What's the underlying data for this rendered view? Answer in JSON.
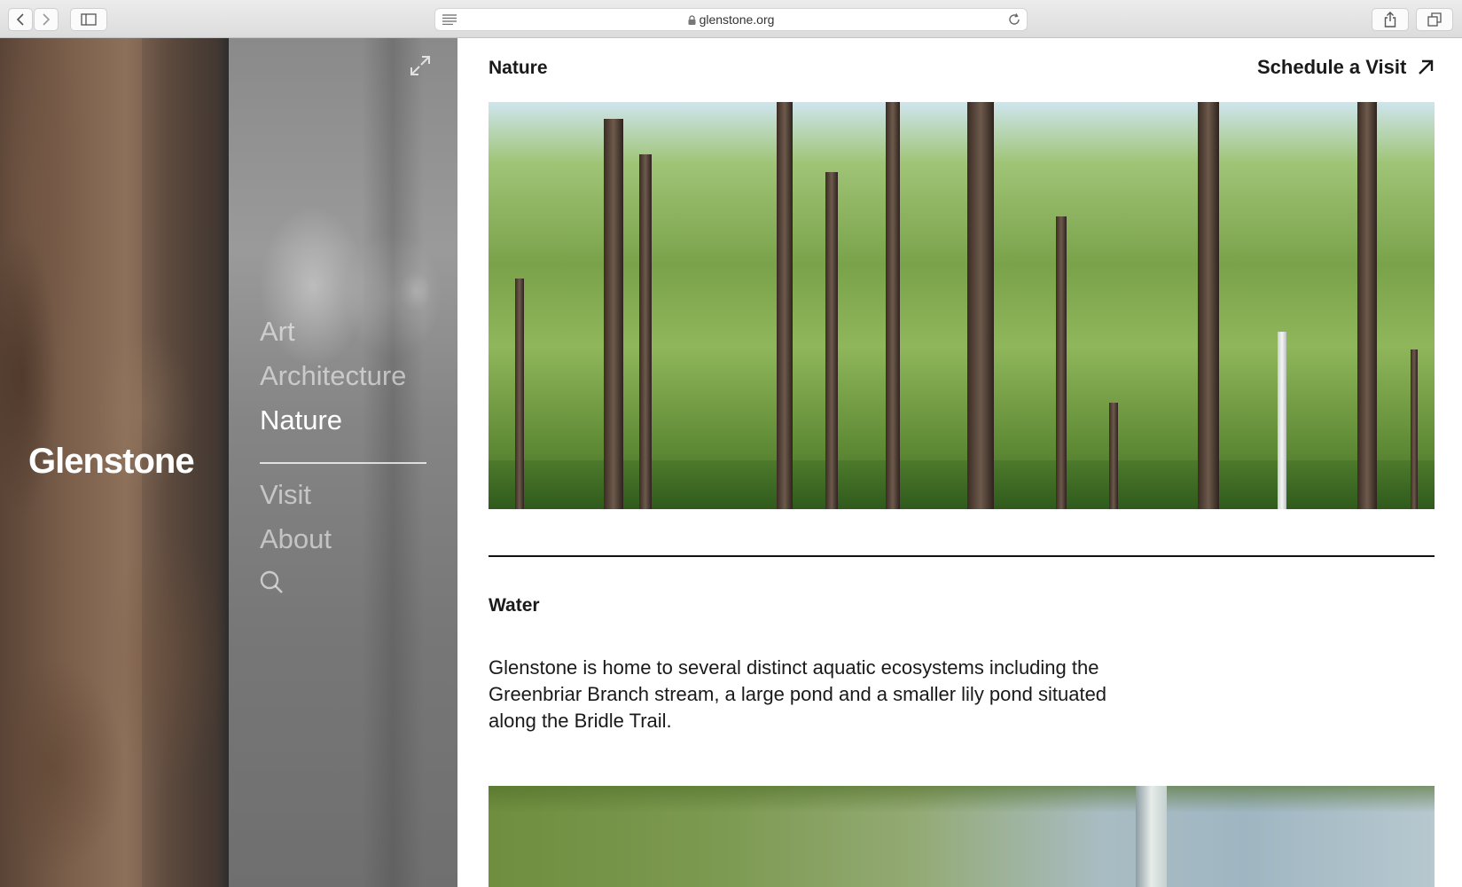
{
  "browser": {
    "url": "glenstone.org",
    "icons": [
      "back-icon",
      "forward-icon",
      "sidebar-icon",
      "reader-icon",
      "lock-icon",
      "reload-icon",
      "share-icon",
      "tabs-icon"
    ]
  },
  "hero": {
    "brand": "Glenstone"
  },
  "nav": {
    "items": [
      {
        "label": "Art",
        "active": false
      },
      {
        "label": "Architecture",
        "active": false
      },
      {
        "label": "Nature",
        "active": true
      },
      {
        "label": "Visit",
        "active": false
      },
      {
        "label": "About",
        "active": false
      }
    ],
    "search_icon": "search-icon",
    "expand_icon": "expand-icon"
  },
  "main": {
    "section_title": "Nature",
    "schedule_label": "Schedule a Visit",
    "schedule_icon": "arrow-up-right-icon",
    "water_title": "Water",
    "water_text": "Glenstone is home to several distinct aquatic ecosystems including the Greenbriar Branch stream, a large pond and a smaller lily pond situated along the Bridle Trail."
  },
  "colors": {
    "text": "#1a1a1a",
    "nav_inactive": "rgba(255,255,255,0.55)",
    "nav_active": "#ffffff"
  }
}
